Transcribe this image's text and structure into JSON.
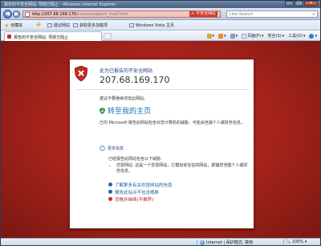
{
  "window": {
    "title": "报告的不安全网站: 导航已阻止 - Windows Internet Explorer"
  },
  "address_bar": {
    "url_highlight": "http://207.68.169.170",
    "url_rest": "/contoso/wpro/l_malf.html",
    "warning_label": "不安全网站",
    "search_placeholder": "Live Search"
  },
  "favorites_bar": {
    "favorites_label": "收藏夹",
    "items": [
      "建议网站",
      "获取更多加载项",
      "Windows Vista 主页"
    ]
  },
  "tab": {
    "label": "报告的不安全网站: 导航已阻止"
  },
  "command_bar": {
    "items": [
      "页面(P)",
      "安全(S)",
      "工具(O)"
    ]
  },
  "card": {
    "heading": "此为已报告的不安全网站",
    "ip": "207.68.169.170",
    "recommendation": "建议不要继续浏览此网站。",
    "home_link": "转至我的主页",
    "report_text": "已向 Microsoft 报告此网站包含对您计算机的威胁，可能会泄漏个人或财务信息。",
    "more_info": "更多信息",
    "detail_intro": "已经报告此网站包含以下威胁:",
    "detail_items": [
      "仿冒网站: 这是一个仿冒网站，它模拟受信任的网站，欺骗您泄露个人或财务信息。"
    ],
    "links": [
      {
        "label": "了解更多有关仿冒网站的信息",
        "danger": false
      },
      {
        "label": "报告此站点不包含威胁",
        "danger": false
      },
      {
        "label": "忽略并继续(不推荐)",
        "danger": true
      }
    ]
  },
  "status_bar": {
    "zone": "Internet | 保护模式: 禁用",
    "zoom": "100%"
  },
  "colors": {
    "danger_red": "#b2281e",
    "link_blue": "#1a6fb0",
    "heading_blue": "#1e3b8a"
  }
}
